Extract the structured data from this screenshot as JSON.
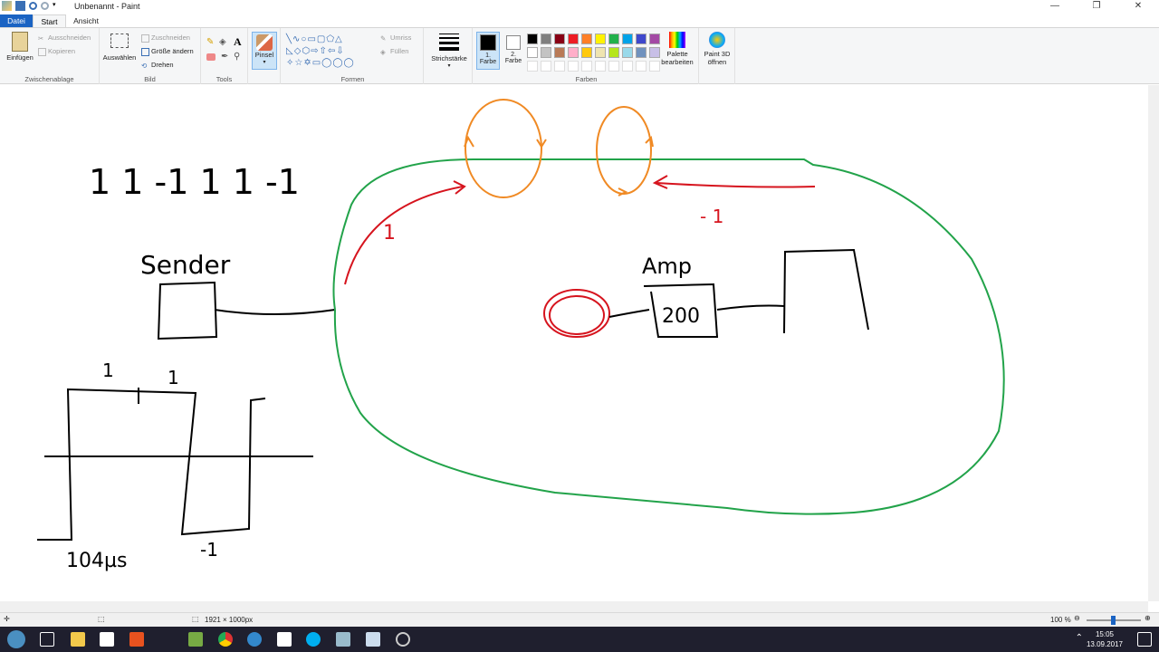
{
  "window": {
    "title": "Unbenannt - Paint"
  },
  "tabs": [
    {
      "label": "Datei"
    },
    {
      "label": "Start"
    },
    {
      "label": "Ansicht"
    }
  ],
  "clipboard": {
    "paste": "Einfügen",
    "cut": "Ausschneiden",
    "copy": "Kopieren",
    "group": "Zwischenablage"
  },
  "image": {
    "select": "Auswählen",
    "crop": "Zuschneiden",
    "resize": "Größe ändern",
    "rotate": "Drehen",
    "group": "Bild"
  },
  "tools": {
    "group": "Tools",
    "brush": "Pinsel"
  },
  "shapes": {
    "outline": "Umriss",
    "fill": "Füllen",
    "group": "Formen"
  },
  "size": {
    "label": "Strichstärke"
  },
  "colors": {
    "color1": "1. Farbe",
    "color2": "2. Farbe",
    "edit": "Palette bearbeiten",
    "paint3d": "Paint 3D öffnen",
    "group": "Farben",
    "row1": [
      "#000000",
      "#7f7f7f",
      "#880015",
      "#ed1c24",
      "#ff7f27",
      "#fff200",
      "#22b14c",
      "#00a2e8",
      "#3f48cc",
      "#a349a4"
    ],
    "row2": [
      "#ffffff",
      "#c3c3c3",
      "#b97a57",
      "#ffaec9",
      "#ffc90e",
      "#efe4b0",
      "#b5e61d",
      "#99d9ea",
      "#7092be",
      "#c8bfe7"
    ]
  },
  "canvas": {
    "handwriting_sequence": "1 1 -1 1 1 -1",
    "sender": "Sender",
    "amp": "Amp",
    "amp_value": "200",
    "wave_top_left": "1",
    "wave_top_right": "1",
    "wave_bottom_left": "104µs",
    "wave_bottom_right": "-1",
    "red_arrow_label_left": "1",
    "red_arrow_label_right": "- 1"
  },
  "status": {
    "dimensions": "1921 × 1000px",
    "zoom": "100 %"
  },
  "clock": {
    "time": "15:05",
    "date": "13.09.2017"
  }
}
